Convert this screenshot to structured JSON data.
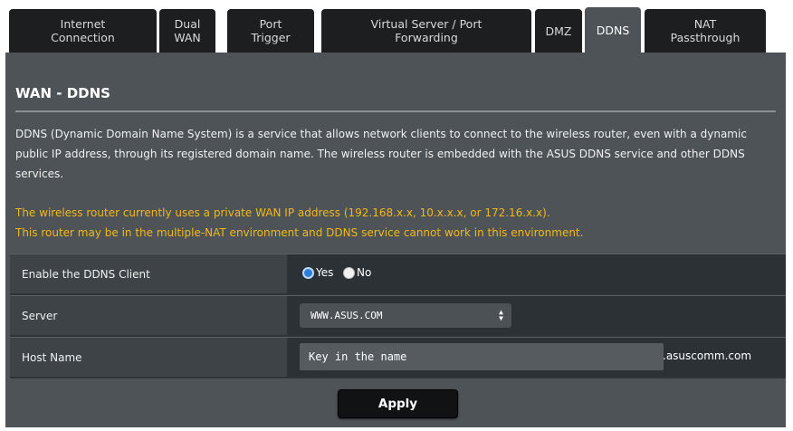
{
  "tabs": [
    {
      "label": "Internet\nConnection"
    },
    {
      "label": "Dual\nWAN"
    },
    {
      "label": "Port\nTrigger"
    },
    {
      "label": "Virtual Server / Port\nForwarding"
    },
    {
      "label": "DMZ"
    },
    {
      "label": "DDNS"
    },
    {
      "label": "NAT\nPassthrough"
    }
  ],
  "active_tab": "DDNS",
  "page": {
    "title": "WAN - DDNS",
    "description": "DDNS (Dynamic Domain Name System) is a service that allows network clients to connect to the wireless router, even with a dynamic public IP address, through its registered domain name. The wireless router is embedded with the ASUS DDNS service and other DDNS services.",
    "warning_line1": "The wireless router currently uses a private WAN IP address (192.168.x.x, 10.x.x.x, or 172.16.x.x).",
    "warning_line2": "This router may be in the multiple-NAT environment and DDNS service cannot work in this environment."
  },
  "form": {
    "enable_label": "Enable the DDNS Client",
    "yes_label": "Yes",
    "no_label": "No",
    "enable_value": "Yes",
    "server_label": "Server",
    "server_value": "WWW.ASUS.COM",
    "host_label": "Host Name",
    "host_placeholder": "Key in the name",
    "host_suffix": ".asuscomm.com"
  },
  "apply_label": "Apply",
  "colors": {
    "panel": "#4d5357",
    "tab": "#1d1e20",
    "warning": "#f2b81a",
    "radio_selected": "#2f7fd8"
  }
}
